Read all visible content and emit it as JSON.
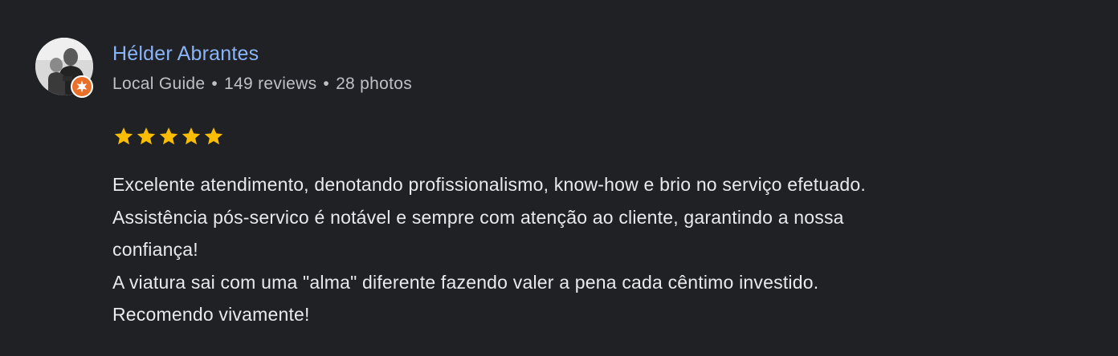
{
  "reviewer": {
    "name": "Hélder Abrantes",
    "level": "Local Guide",
    "reviews": "149 reviews",
    "photos": "28 photos",
    "separator": "•"
  },
  "rating": {
    "stars": 5,
    "max": 5,
    "star_color": "#fbbc04"
  },
  "review": {
    "lines": [
      "Excelente atendimento, denotando profissionalismo, know-how e brio no serviço efetuado.",
      "Assistência pós-servico é notável e sempre com atenção ao cliente, garantindo a nossa",
      "confiança!",
      "A viatura sai com uma \"alma\" diferente fazendo valer a pena cada cêntimo investido.",
      "Recomendo vivamente!"
    ]
  },
  "colors": {
    "background": "#202124",
    "name": "#8ab4f8",
    "meta": "#bdc1c6",
    "text": "#e8eaed",
    "badge": "#e8702a"
  },
  "icons": {
    "avatar": "profile-photo",
    "badge": "local-guide-badge-icon",
    "star": "star-icon"
  }
}
